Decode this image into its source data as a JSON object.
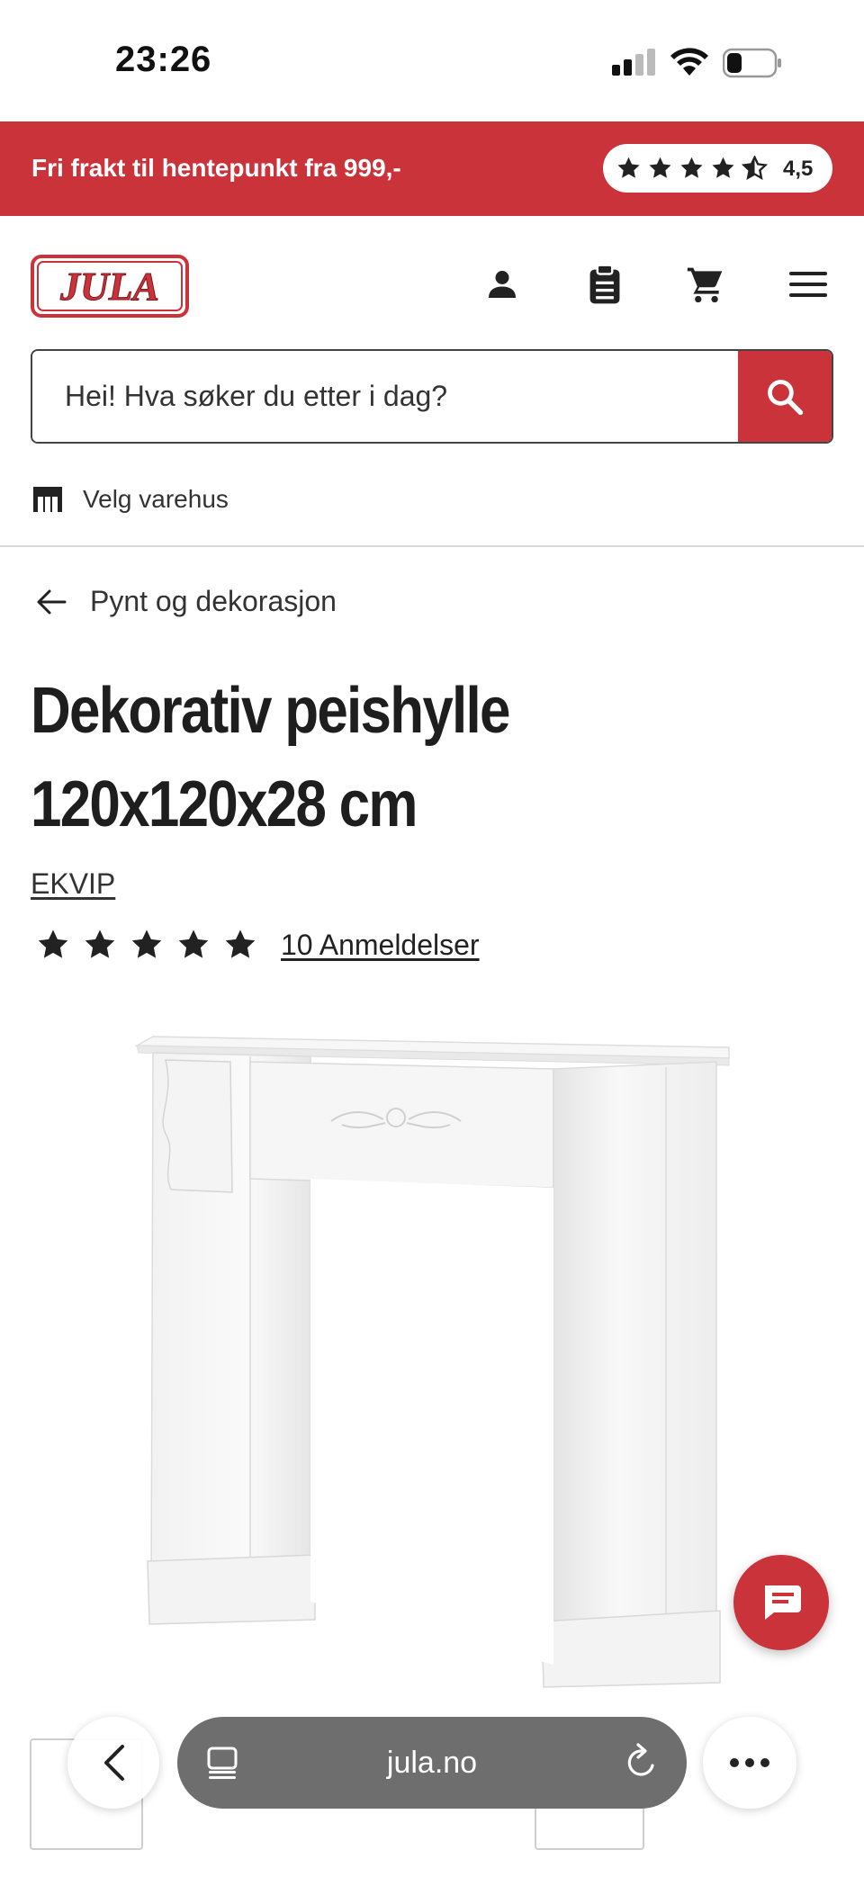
{
  "status_bar": {
    "time": "23:26"
  },
  "promo": {
    "text": "Fri frakt til hentepunkt fra 999,-",
    "rating_value": "4,5",
    "rating_stars": 4.5
  },
  "header": {
    "logo_text": "JULA",
    "icons": [
      "account-icon",
      "clipboard-icon",
      "cart-icon",
      "menu-icon"
    ]
  },
  "search": {
    "placeholder": "Hei! Hva søker du etter i dag?"
  },
  "store_selector": {
    "label": "Velg varehus"
  },
  "breadcrumb": {
    "label": "Pynt og dekorasjon"
  },
  "product": {
    "title_line1": "Dekorativ peishylle",
    "title_line2": "120x120x28 cm",
    "brand": "EKVIP",
    "rating_stars": 5,
    "reviews_label": "10 Anmeldelser"
  },
  "browser": {
    "url": "jula.no"
  },
  "colors": {
    "brand_red": "#cb333b",
    "text_dark": "#222222",
    "url_pill": "#6e6e6e"
  }
}
